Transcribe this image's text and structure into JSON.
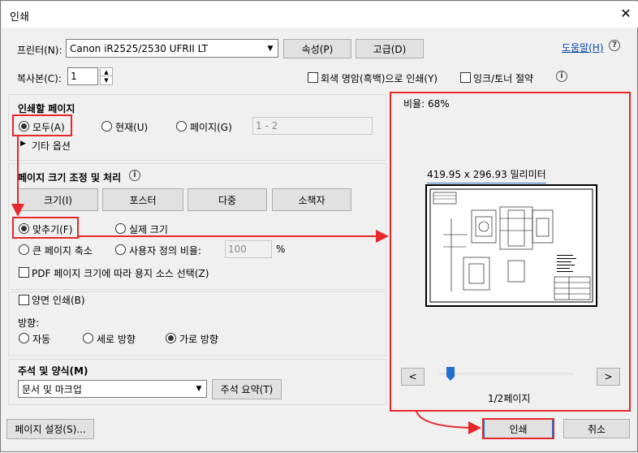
{
  "window": {
    "title": "인쇄",
    "close_glyph": "✕"
  },
  "printer": {
    "label": "프린터(N):",
    "value": "Canon iR2525/2530 UFRII LT",
    "properties_button": "속성(P)",
    "advanced_button": "고급(D)",
    "help_link": "도움말(H)"
  },
  "copies": {
    "label": "복사본(C):",
    "value": "1"
  },
  "options": {
    "grayscale_label": "회색 명암(흑백)으로 인쇄(Y)",
    "grayscale_checked": false,
    "save_ink_label": "잉크/토너 절약",
    "save_ink_checked": false
  },
  "pages_to_print": {
    "heading": "인쇄할 페이지",
    "all_label": "모두(A)",
    "current_label": "현재(U)",
    "pages_label": "페이지(G)",
    "pages_range": "1 - 2",
    "selected": "all",
    "more_options": "기타 옵션"
  },
  "page_sizing": {
    "heading": "페이지 크기 조정 및 처리",
    "buttons": [
      "크기(I)",
      "포스터",
      "다중",
      "소책자"
    ],
    "fit_label": "맞추기(F)",
    "actual_size_label": "실제 크기",
    "shrink_label": "큰 페이지 축소",
    "custom_scale_label": "사용자 정의 비율:",
    "custom_scale_value": "100",
    "percent": "%",
    "selected": "fit",
    "choose_source_label": "PDF 페이지 크기에 따라 용지 소스 선택(Z)",
    "choose_source_checked": false
  },
  "duplex": {
    "label": "양면 인쇄(B)",
    "checked": false
  },
  "orientation": {
    "heading": "방향:",
    "auto_label": "자동",
    "portrait_label": "세로 방향",
    "landscape_label": "가로 방향",
    "selected": "landscape"
  },
  "comments": {
    "heading": "주석 및 양식(M)",
    "value": "문서 및 마크업",
    "summary_button": "주석 요약(T)"
  },
  "preview": {
    "scale": "비율:  68%",
    "dimensions": "419.95 x 296.93 밀리미터",
    "prev_glyph": "<",
    "next_glyph": ">",
    "page_indicator": "1/2페이지",
    "slider_position": 0
  },
  "footer": {
    "page_setup_button": "페이지 설정(S)...",
    "print_button": "인쇄",
    "cancel_button": "취소"
  },
  "colors": {
    "annotation_red": "#e8272b",
    "link_blue": "#0645ad"
  }
}
